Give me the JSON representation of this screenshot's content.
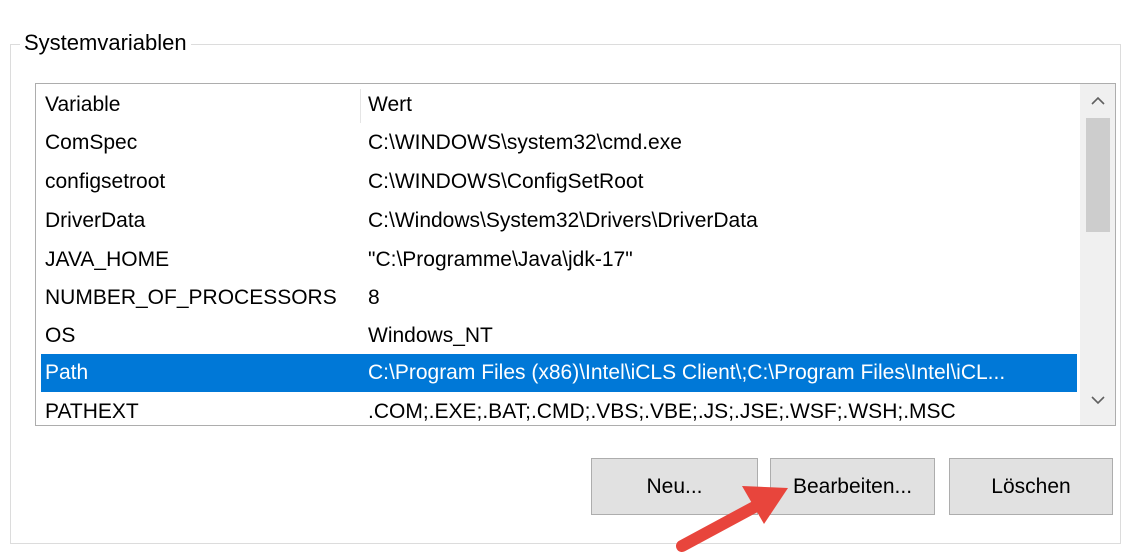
{
  "group": {
    "title": "Systemvariablen"
  },
  "table": {
    "columns": [
      "Variable",
      "Wert"
    ],
    "rows": [
      {
        "variable": "ComSpec",
        "value": "C:\\WINDOWS\\system32\\cmd.exe"
      },
      {
        "variable": "configsetroot",
        "value": "C:\\WINDOWS\\ConfigSetRoot"
      },
      {
        "variable": "DriverData",
        "value": "C:\\Windows\\System32\\Drivers\\DriverData"
      },
      {
        "variable": "JAVA_HOME",
        "value": "\"C:\\Programme\\Java\\jdk-17\""
      },
      {
        "variable": "NUMBER_OF_PROCESSORS",
        "value": "8"
      },
      {
        "variable": "OS",
        "value": "Windows_NT"
      },
      {
        "variable": "Path",
        "value": "C:\\Program Files (x86)\\Intel\\iCLS Client\\;C:\\Program Files\\Intel\\iCL..."
      },
      {
        "variable": "PATHEXT",
        "value": ".COM;.EXE;.BAT;.CMD;.VBS;.VBE;.JS;.JSE;.WSF;.WSH;.MSC"
      }
    ],
    "selected_variable": "Path"
  },
  "scrollbar": {
    "up_icon": "chevron-up-icon",
    "down_icon": "chevron-down-icon"
  },
  "buttons": {
    "new_label": "Neu...",
    "edit_label": "Bearbeiten...",
    "delete_label": "Löschen"
  },
  "annotation": {
    "arrow_color": "#e8453c",
    "arrow_icon": "red-arrow-icon"
  },
  "colors": {
    "selection": "#0078d7",
    "button_bg": "#e1e1e1"
  }
}
